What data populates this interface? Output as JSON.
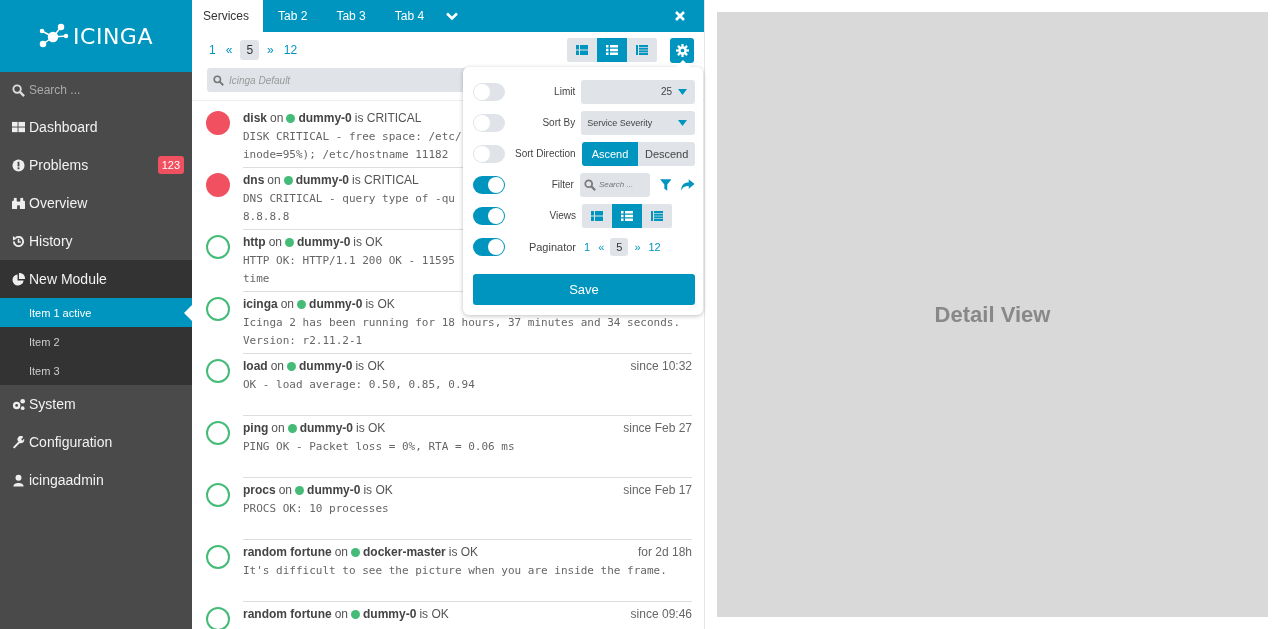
{
  "sidebar": {
    "logo": "ICINGA",
    "search": {
      "placeholder": "Search ..."
    },
    "items": [
      {
        "label": "Dashboard",
        "selected": false
      },
      {
        "label": "Problems",
        "badge": "123",
        "selected": false
      },
      {
        "label": "Overview",
        "selected": false
      },
      {
        "label": "History",
        "selected": false
      },
      {
        "label": "New Module",
        "selected": false,
        "expanded": true,
        "children": [
          {
            "label": "Item 1 active",
            "selected": true
          },
          {
            "label": "Item 2",
            "selected": false
          },
          {
            "label": "Item 3",
            "selected": false
          }
        ]
      },
      {
        "label": "System",
        "selected": false
      },
      {
        "label": "Configuration",
        "selected": false
      },
      {
        "label": "icingaadmin",
        "selected": false
      }
    ]
  },
  "tabs": [
    {
      "label": "Services",
      "selected": true
    },
    {
      "label": "Tab 2",
      "selected": false
    },
    {
      "label": "Tab 3",
      "selected": false
    },
    {
      "label": "Tab 4",
      "selected": false
    }
  ],
  "paginator": {
    "first": "1",
    "prev": "«",
    "current": "5",
    "next": "»",
    "last": "12"
  },
  "views": [
    {
      "kind": "compact",
      "selected": false
    },
    {
      "kind": "default",
      "selected": true
    },
    {
      "kind": "detailed",
      "selected": false
    }
  ],
  "filter": {
    "placeholder": "Icinga Default"
  },
  "services": [
    {
      "kind": "critical",
      "service": "disk",
      "connector": "on",
      "host": "dummy-0",
      "status_text": "is CRITICAL",
      "output": [
        "DISK CRITICAL - free space: /etc/",
        "inode=95%); /etc/hostname 11182"
      ]
    },
    {
      "kind": "critical",
      "service": "dns",
      "connector": "on",
      "host": "dummy-0",
      "status_text": "is CRITICAL",
      "output": [
        "DNS CRITICAL - query type of -qu",
        "8.8.8.8"
      ]
    },
    {
      "kind": "ok",
      "service": "http",
      "connector": "on",
      "host": "dummy-0",
      "status_text": "is OK",
      "output": [
        "HTTP OK: HTTP/1.1 200 OK - 11595",
        "time"
      ]
    },
    {
      "kind": "ok",
      "service": "icinga",
      "connector": "on",
      "host": "dummy-0",
      "status_text": "is OK",
      "output": [
        "Icinga 2 has been running for 18 hours, 37 minutes and 34 seconds.",
        "Version: r2.11.2-1"
      ]
    },
    {
      "kind": "ok",
      "service": "load",
      "connector": "on",
      "host": "dummy-0",
      "status_text": "is OK",
      "time": "since 10:32",
      "output": [
        "OK - load average: 0.50, 0.85, 0.94"
      ]
    },
    {
      "kind": "ok",
      "service": "ping",
      "connector": "on",
      "host": "dummy-0",
      "status_text": "is OK",
      "time": "since Feb 27",
      "output": [
        "PING OK - Packet loss = 0%, RTA = 0.06 ms"
      ]
    },
    {
      "kind": "ok",
      "service": "procs",
      "connector": "on",
      "host": "dummy-0",
      "status_text": "is OK",
      "time": "since Feb 17",
      "output": [
        "PROCS OK: 10 processes"
      ]
    },
    {
      "kind": "ok",
      "service": "random fortune",
      "connector": "on",
      "host": "docker-master",
      "status_text": "is OK",
      "time": "for 2d 18h",
      "output": [
        "It's difficult to see the picture when you are inside the frame."
      ]
    },
    {
      "kind": "ok",
      "service": "random fortune",
      "connector": "on",
      "host": "dummy-0",
      "status_text": "is OK",
      "time": "since 09:46"
    }
  ],
  "settings": {
    "rows": [
      {
        "kind": "number",
        "on": false,
        "label": "Limit",
        "value": "25"
      },
      {
        "kind": "select",
        "on": false,
        "label": "Sort By",
        "value": "Service Severity"
      },
      {
        "kind": "segmented",
        "on": false,
        "label": "Sort Direction",
        "options": [
          {
            "label": "Ascend",
            "selected": true
          },
          {
            "label": "Descend",
            "selected": false
          }
        ]
      },
      {
        "kind": "filter",
        "on": true,
        "label": "Filter",
        "placeholder": "Search ..."
      },
      {
        "kind": "views",
        "on": true,
        "label": "Views"
      },
      {
        "kind": "paginator",
        "on": true,
        "label": "Paginator",
        "pages": {
          "first": "1",
          "prev": "«",
          "current": "5",
          "next": "»",
          "last": "12"
        }
      }
    ],
    "save": "Save"
  },
  "detail": {
    "title": "Detail View"
  }
}
